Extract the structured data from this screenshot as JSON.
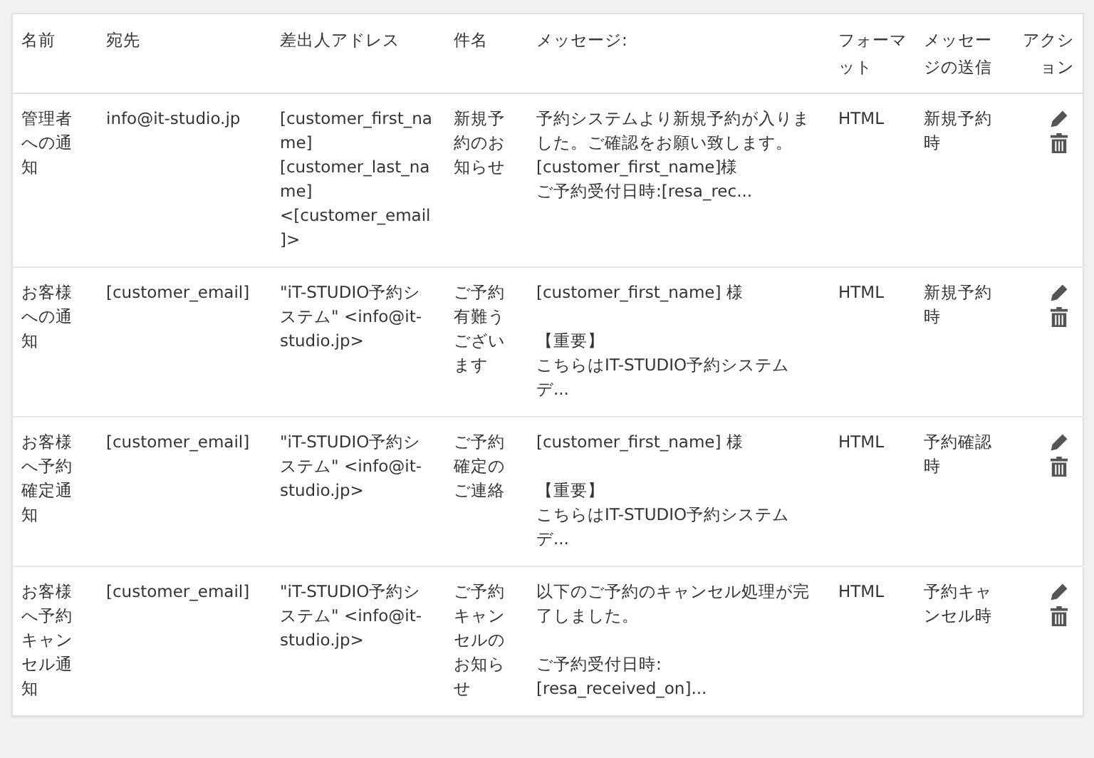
{
  "table": {
    "columns": [
      "名前",
      "宛先",
      "差出人アドレス",
      "件名",
      "メッセージ:",
      "フォーマット",
      "メッセージの送信",
      "アクション"
    ],
    "rows": [
      {
        "name": "管理者への通知",
        "to": "info@it-studio.jp",
        "from": "[customer_first_name] [customer_last_name] <[customer_email]>",
        "subject": "新規予約のお知らせ",
        "message_paragraphs": [
          [
            "予約システムより新規予約が入りました。ご確認をお願い致します。",
            "[customer_first_name]様",
            "ご予約受付日時:[resa_rec..."
          ]
        ],
        "format": "HTML",
        "send": "新規予約時"
      },
      {
        "name": "お客様への通知",
        "to": "[customer_email]",
        "from": "\"iT-STUDIO予約システム\" <info@it-studio.jp>",
        "subject": "ご予約有難うございます",
        "message_paragraphs": [
          [
            "[customer_first_name] 様"
          ],
          [
            "【重要】",
            "こちらはIT-STUDIO予約システムデ..."
          ]
        ],
        "format": "HTML",
        "send": "新規予約時"
      },
      {
        "name": "お客様へ予約確定通知",
        "to": "[customer_email]",
        "from": "\"iT-STUDIO予約システム\" <info@it-studio.jp>",
        "subject": "ご予約確定のご連絡",
        "message_paragraphs": [
          [
            "[customer_first_name] 様"
          ],
          [
            "【重要】",
            "こちらはIT-STUDIO予約システムデ..."
          ]
        ],
        "format": "HTML",
        "send": "予約確認時"
      },
      {
        "name": "お客様へ予約キャンセル通知",
        "to": "[customer_email]",
        "from": "\"iT-STUDIO予約システム\" <info@it-studio.jp>",
        "subject": "ご予約キャンセルのお知らせ",
        "message_paragraphs": [
          [
            "以下のご予約のキャンセル処理が完了しました。"
          ],
          [
            "ご予約受付日時:",
            "[resa_received_on]..."
          ]
        ],
        "format": "HTML",
        "send": "予約キャンセル時"
      }
    ]
  }
}
